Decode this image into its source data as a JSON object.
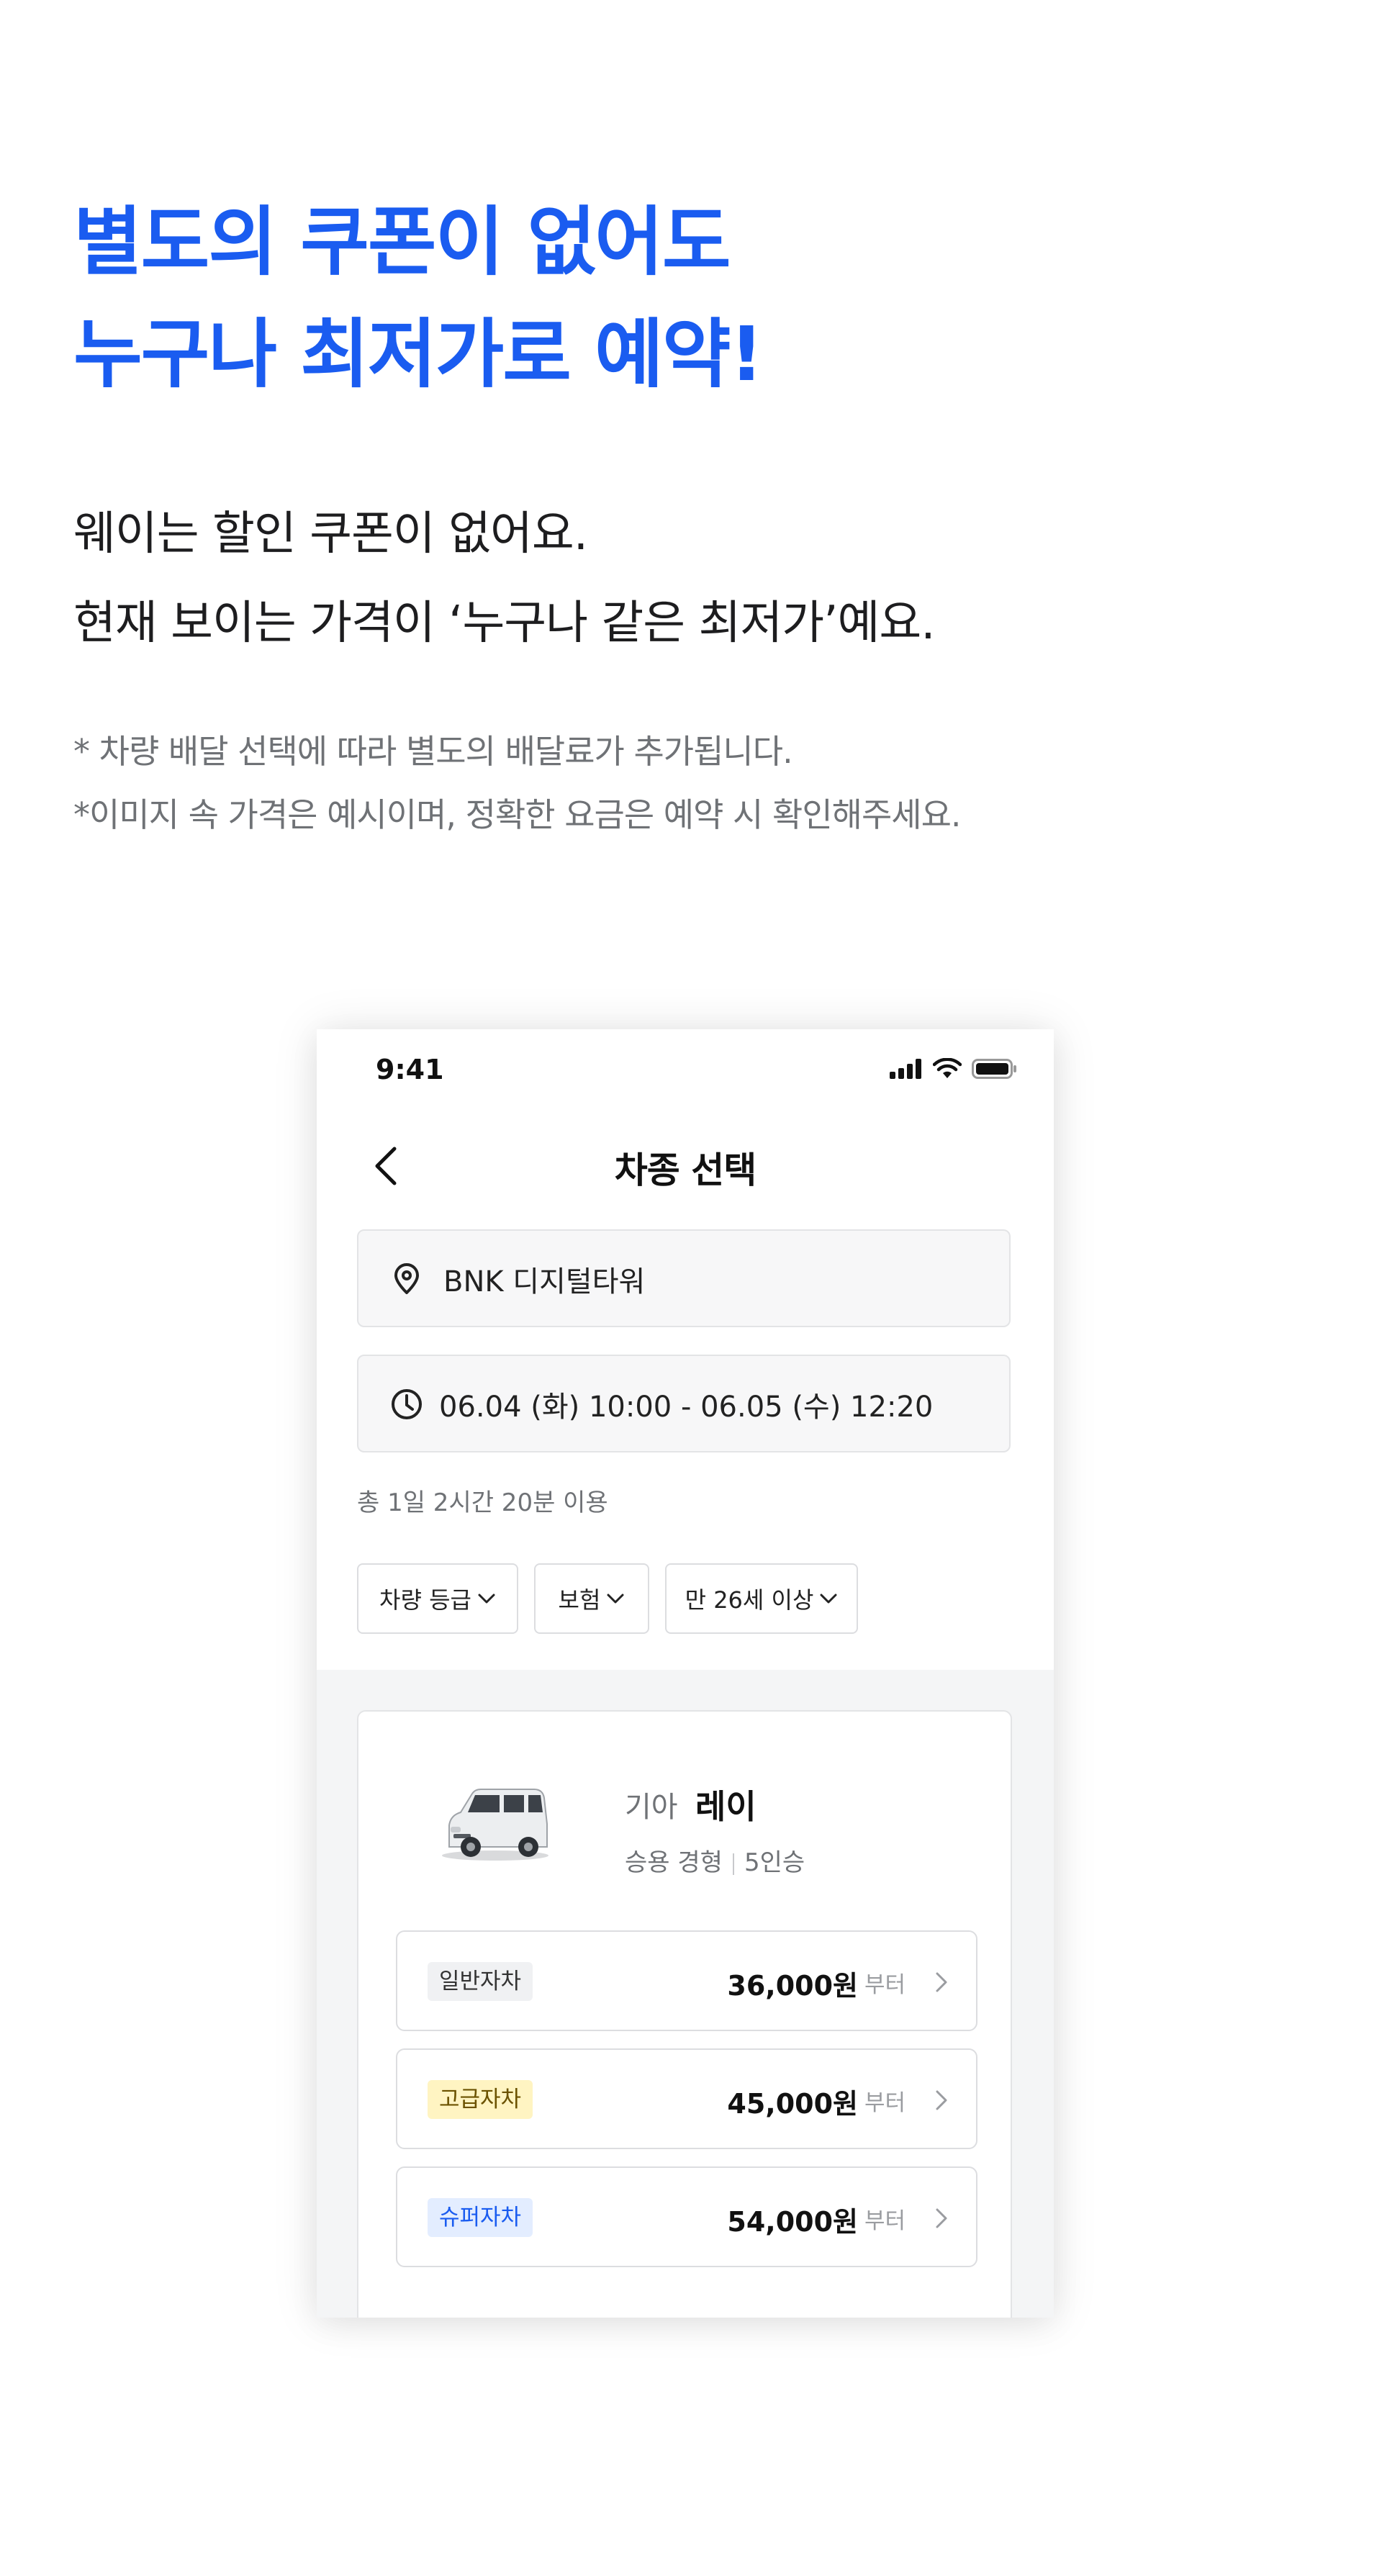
{
  "headline": {
    "line1": "별도의 쿠폰이 없어도",
    "line2": "누구나 최저가로 예약!"
  },
  "description": {
    "line1": "웨이는 할인 쿠폰이 없어요.",
    "line2": "현재 보이는 가격이 ‘누구나 같은 최저가’예요."
  },
  "notes": {
    "line1": "* 차량 배달 선택에 따라 별도의 배달료가 추가됩니다.",
    "line2": "*이미지 속 가격은 예시이며, 정확한 요금은 예약 시 확인해주세요."
  },
  "colors": {
    "accent": "#1a5cf0"
  },
  "phone": {
    "status_time": "9:41",
    "status_icons": [
      "signal-icon",
      "wifi-icon",
      "battery-icon"
    ],
    "nav_title": "차종 선택",
    "location": "BNK 디지털타워",
    "datetime": "06.04 (화) 10:00  -  06.05 (수) 12:20",
    "usage": "총 1일 2시간 20분 이용",
    "filters": [
      "차량 등급",
      "보험",
      "만 26세 이상"
    ],
    "car": {
      "brand": "기아",
      "model": "레이",
      "type": "승용 경형",
      "seats": "5인승",
      "options": [
        {
          "grade": "일반자차",
          "price": "36,000원",
          "suffix": "부터",
          "badge_bg": "#f0f1f3",
          "badge_fg": "#333333"
        },
        {
          "grade": "고급자차",
          "price": "45,000원",
          "suffix": "부터",
          "badge_bg": "#fff4c2",
          "badge_fg": "#6b5200"
        },
        {
          "grade": "슈퍼자차",
          "price": "54,000원",
          "suffix": "부터",
          "badge_bg": "#e3edff",
          "badge_fg": "#1a5cf0"
        }
      ]
    }
  }
}
